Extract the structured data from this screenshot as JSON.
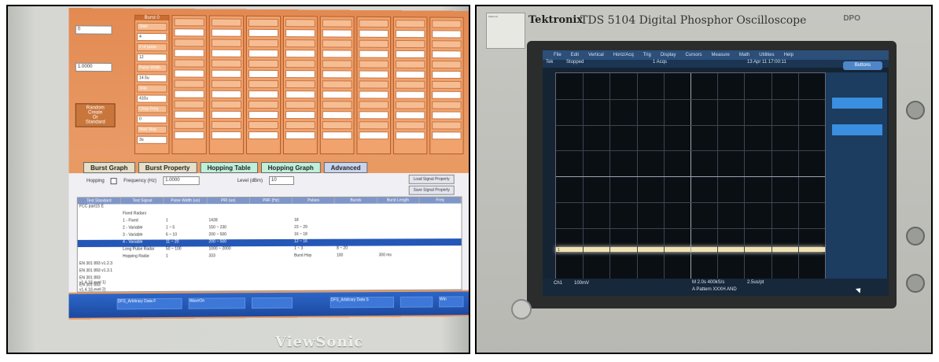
{
  "left_photo": {
    "brand": "ViewSonic",
    "tabs": [
      "Burst Graph",
      "Burst Property",
      "Hopping Table",
      "Hopping Graph",
      "Advanced"
    ],
    "left_panel": {
      "value1": "0",
      "value2": "1.0000",
      "button_lines": [
        "Random",
        "Create",
        "Or",
        "Standard"
      ]
    },
    "burst": {
      "first_header": "Burst 0",
      "row_labels": [
        "Start",
        "4",
        "# of pulse",
        "12",
        "Pulse Width",
        "14.5u",
        "Skip",
        "410u",
        "Chirp Freq",
        "0",
        "Wait Stop",
        "3u"
      ],
      "column_count": 9
    },
    "controls": {
      "hopping_label": "Hopping",
      "freq_label": "Frequency (Hz)",
      "freq_value": "1.0000",
      "level_label": "Level (dBm)",
      "level_value": "10",
      "load_btn": "Load Signal Property",
      "save_btn": "Save Signal Property"
    },
    "table": {
      "headers": [
        "Test Standard",
        "Test Signal",
        "Pulse Width (us)",
        "PRI (us)",
        "PRF (Hz)",
        "Pulses",
        "Bursts",
        "Burst Length",
        "Freq"
      ],
      "rows": [
        [
          "FCC part15 E",
          "",
          "",
          "",
          "",
          "",
          "",
          "",
          ""
        ],
        [
          "",
          "Fixed Radars",
          "",
          "",
          "",
          "",
          "",
          "",
          ""
        ],
        [
          "",
          "1 - Fixed",
          "1",
          "1428",
          "",
          "18",
          "",
          "",
          ""
        ],
        [
          "",
          "2 - Variable",
          "1 ~ 5",
          "150 ~ 230",
          "",
          "23 ~ 29",
          "",
          "",
          ""
        ],
        [
          "",
          "3 - Variable",
          "6 ~ 10",
          "200 ~ 500",
          "",
          "16 ~ 18",
          "",
          "",
          ""
        ],
        [
          "",
          "4 - Variable",
          "11 ~ 20",
          "200 ~ 500",
          "",
          "12 ~ 16",
          "",
          "",
          ""
        ],
        [
          "",
          "Long Pulse Radar",
          "50 ~ 100",
          "1000 ~ 2000",
          "",
          "1 ~ 3",
          "8 ~ 20",
          "",
          ""
        ],
        [
          "",
          "Hopping Radar",
          "1",
          "333",
          "",
          "Burst Hop",
          "100",
          "300 ms",
          ""
        ],
        [
          "EN 301 893 v1.2.3",
          "",
          "",
          "",
          "",
          "",
          "",
          "",
          ""
        ],
        [
          "EN 301 893 v1.3.1",
          "",
          "",
          "",
          "",
          "",
          "",
          "",
          ""
        ],
        [
          "EN 301 893 v1.4.1(Level 1)",
          "",
          "",
          "",
          "",
          "",
          "",
          "",
          ""
        ],
        [
          "EN 301 893 v1.4.1(Level 2)",
          "",
          "",
          "",
          "",
          "",
          "",
          "",
          ""
        ]
      ],
      "selected_row": 5
    },
    "taskbar_items": [
      "DFS_Arbitrary Data F",
      "WaveOn",
      "",
      "DFS_Arbitrary Data S",
      "",
      "Win"
    ]
  },
  "right_photo": {
    "sticker_text": "Tektronix",
    "brand": "Tektronix",
    "model": "TDS 5104 Digital Phosphor Oscilloscope",
    "dpo_badge": "DPO",
    "menu": [
      "File",
      "Edit",
      "Vertical",
      "Horiz/Acq",
      "Trig",
      "Display",
      "Cursors",
      "Measure",
      "Math",
      "Utilities",
      "Help"
    ],
    "status": {
      "left": "Tek",
      "mode": "Stopped",
      "acq": "1 Acqs",
      "time": "13 Apr 11 17:00:11"
    },
    "side_button": "Buttons",
    "readout": {
      "ch": "Ch1",
      "scale": "100mV",
      "timebase": "M 2.0s 400kS/s",
      "sample": "2.5us/pt",
      "trigger": "A Pattern XXXH AND"
    },
    "ch_marker": "1"
  }
}
